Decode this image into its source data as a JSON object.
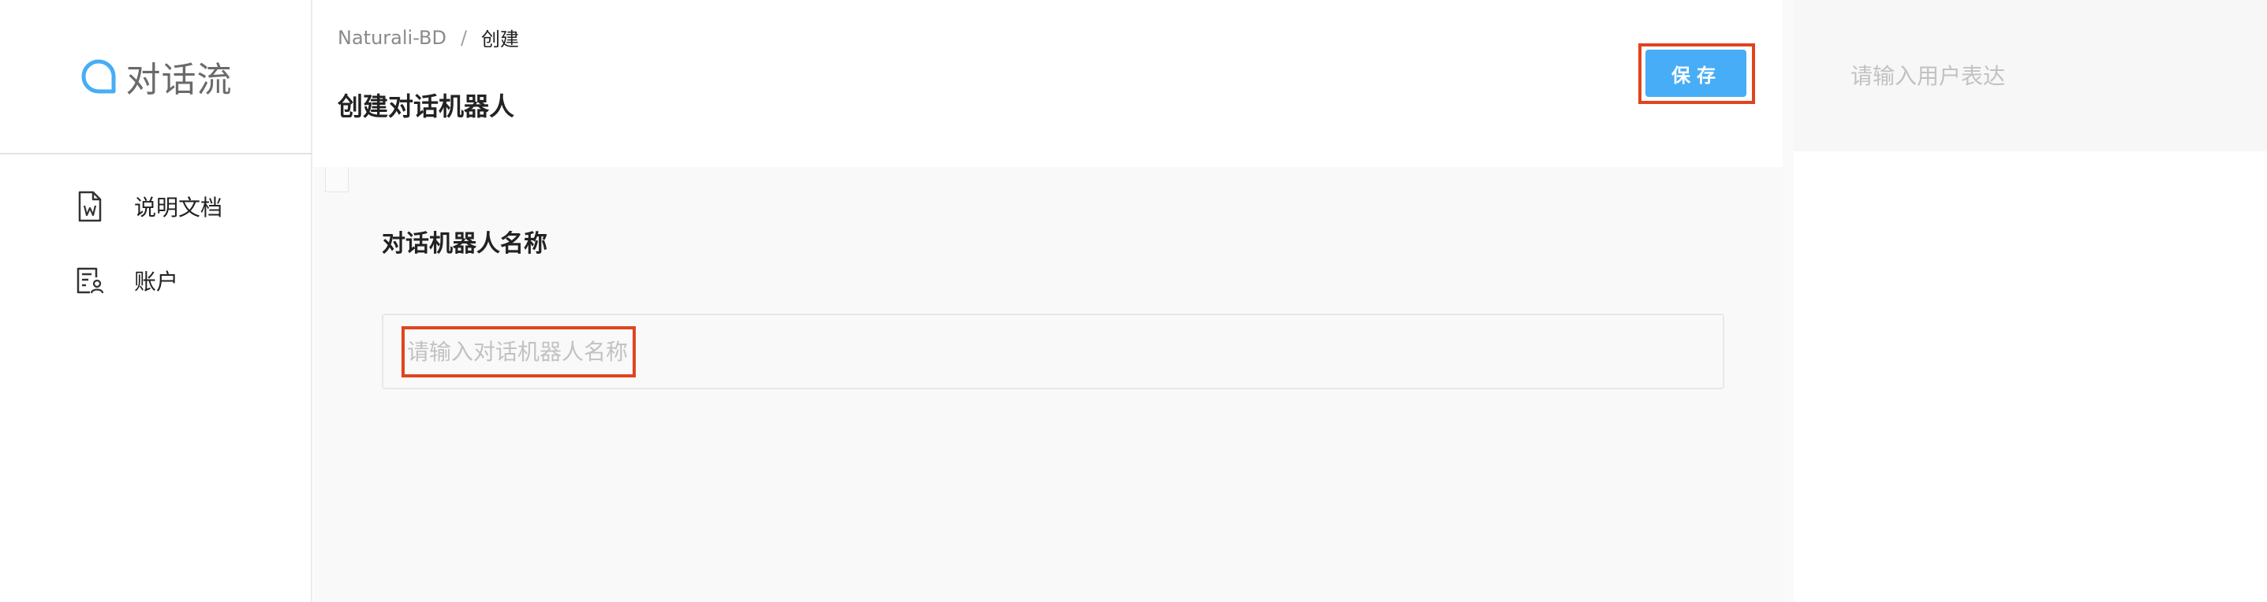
{
  "sidebar": {
    "logo_text": "对话流",
    "logo_icon": "chat-bubble-icon",
    "items": [
      {
        "label": "说明文档",
        "icon": "document-word-icon"
      },
      {
        "label": "账户",
        "icon": "account-card-icon"
      }
    ]
  },
  "header": {
    "breadcrumb": {
      "root": "Naturali-BD",
      "separator": "/",
      "current": "创建"
    },
    "title": "创建对话机器人",
    "save_label": "保存"
  },
  "form": {
    "name_label": "对话机器人名称",
    "name_placeholder": "请输入对话机器人名称",
    "name_value": ""
  },
  "right_panel": {
    "utterance_placeholder": "请输入用户表达"
  },
  "colors": {
    "accent": "#47adf6",
    "highlight": "#e0441f",
    "logo": "#47adf6"
  }
}
